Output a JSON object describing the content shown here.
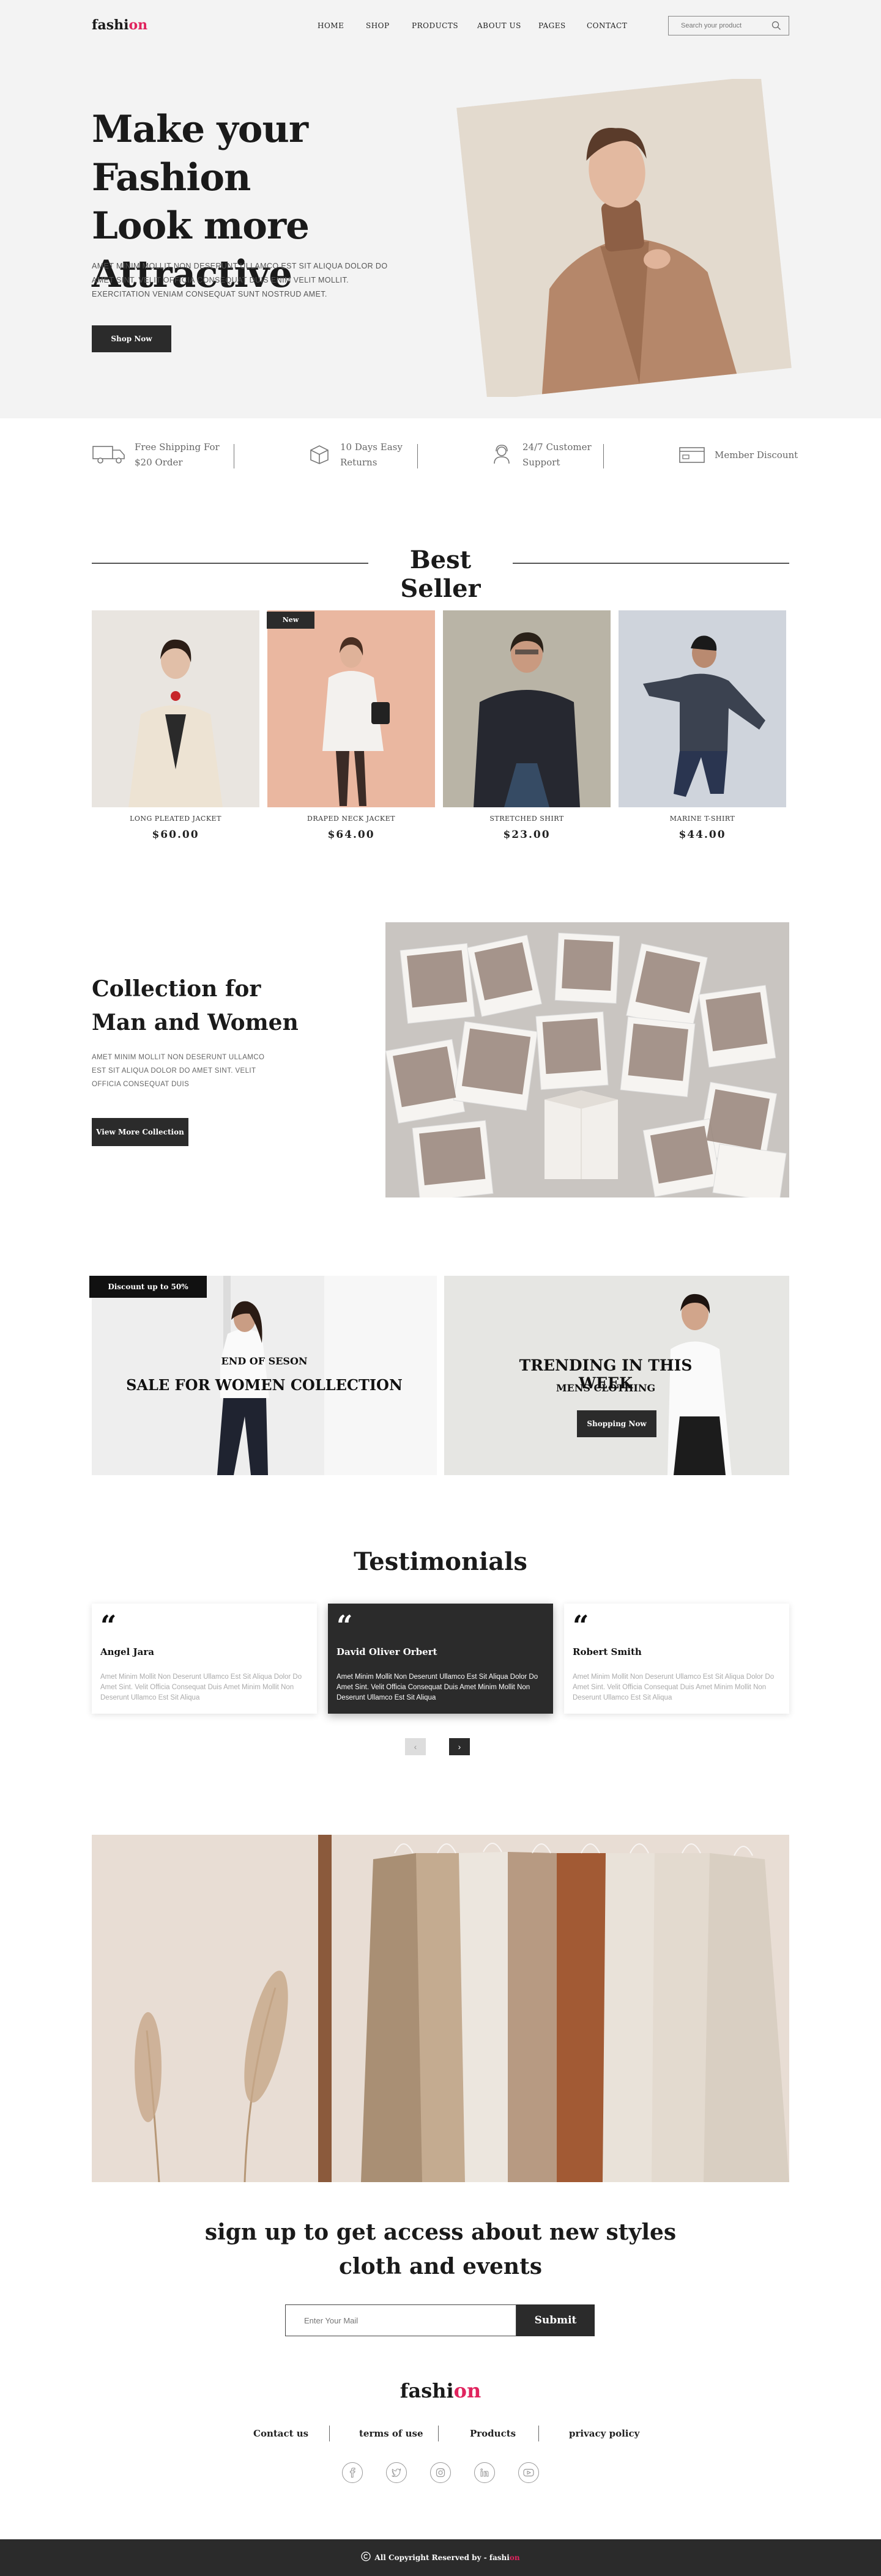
{
  "brand": {
    "name_main": "fashi",
    "name_accent": "on",
    "accent_color": "#e0245e"
  },
  "nav": {
    "items": [
      "HOME",
      "SHOP",
      "PRODUCTS",
      "ABOUT US",
      "PAGES",
      "CONTACT"
    ],
    "search_placeholder": "Search your product"
  },
  "hero": {
    "title_line1": "Make your Fashion",
    "title_line2": "Look more",
    "title_line3": "Attractive",
    "text": "AMET MINIM MOLLIT NON DESERUNT ULLAMCO EST SIT ALIQUA DOLOR DO AMET SINT. VELIT OFFICIA CONSEQUAT DUIS ENIM VELIT MOLLIT. EXERCITATION VENIAM CONSEQUAT SUNT NOSTRUD AMET.",
    "button": "Shop Now"
  },
  "features": [
    {
      "line1": "Free Shipping For",
      "line2": "$20   Order",
      "icon": "truck-icon"
    },
    {
      "line1": "10 Days Easy",
      "line2": "Returns",
      "icon": "box-icon"
    },
    {
      "line1": "24/7 Customer",
      "line2": "Support",
      "icon": "support-icon"
    },
    {
      "line1": "Member Discount",
      "line2": "",
      "icon": "card-icon"
    }
  ],
  "best_seller": {
    "title": "Best Seller",
    "badge": "New",
    "products": [
      {
        "name": "LONG PLEATED JACKET",
        "price": "$60.00"
      },
      {
        "name": "DRAPED NECK JACKET",
        "price": "$64.00"
      },
      {
        "name": "STRETCHED SHIRT",
        "price": "$23.00"
      },
      {
        "name": "MARINE T-SHIRT",
        "price": "$44.00"
      }
    ]
  },
  "collection": {
    "title_line1": "Collection for",
    "title_line2": "Man and Women",
    "text": "AMET MINIM MOLLIT NON DESERUNT ULLAMCO EST SIT ALIQUA DOLOR DO AMET SINT. VELIT OFFICIA CONSEQUAT DUIS",
    "button": "View More Collection"
  },
  "banners": {
    "left": {
      "badge": "Discount up to 50%",
      "subtitle": "END OF SESON",
      "title": "SALE FOR WOMEN COLLECTION"
    },
    "right": {
      "title": "TRENDING  IN THIS WEEK",
      "subtitle": "MENS CLOTHING",
      "button": "Shopping Now"
    }
  },
  "testimonials": {
    "title": "Testimonials",
    "quote_mark": "“",
    "items": [
      {
        "name": "Angel Jara",
        "text": "Amet Minim Mollit Non Deserunt Ullamco Est Sit Aliqua Dolor Do Amet Sint. Velit Officia Consequat Duis Amet Minim Mollit Non Deserunt Ullamco Est Sit Aliqua"
      },
      {
        "name": "David Oliver Orbert",
        "text": "Amet Minim Mollit Non Deserunt Ullamco Est Sit Aliqua Dolor Do Amet Sint. Velit Officia Consequat Duis Amet Minim Mollit Non Deserunt Ullamco Est Sit Aliqua"
      },
      {
        "name": "Robert Smith",
        "text": "Amet Minim Mollit Non Deserunt Ullamco Est Sit Aliqua Dolor Do Amet Sint. Velit Officia Consequat Duis Amet Minim Mollit Non Deserunt Ullamco Est Sit Aliqua"
      }
    ],
    "prev": "‹",
    "next": "›"
  },
  "signup": {
    "title_line1": "sign up to get access about new styles",
    "title_line2": "cloth and events",
    "placeholder": "Enter Your Mail",
    "button": "Submit"
  },
  "footer": {
    "links": [
      "Contact us",
      "terms of use",
      "Products",
      "privacy policy"
    ],
    "social": [
      "facebook-icon",
      "twitter-icon",
      "instagram-icon",
      "linkedin-icon",
      "youtube-icon"
    ],
    "copyright_text": "All Copyright Reserved by - ",
    "copyright_brand_main": "fashi",
    "copyright_brand_accent": "on"
  }
}
